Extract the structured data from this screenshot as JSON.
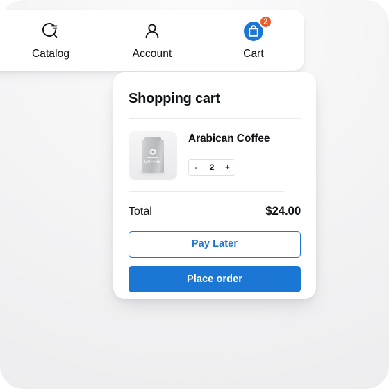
{
  "colors": {
    "accent_blue": "#1c77d4",
    "badge_orange": "#ec5b2b",
    "text_dark": "#111216",
    "panel_white": "#ffffff",
    "page_bg": "#ececee"
  },
  "navbar": {
    "items": [
      {
        "label": "Catalog",
        "icon": "catalog-search-icon"
      },
      {
        "label": "Account",
        "icon": "user-icon"
      },
      {
        "label": "Cart",
        "icon": "shopping-bag-icon",
        "badge": "2"
      }
    ]
  },
  "cart": {
    "title": "Shopping cart",
    "items": [
      {
        "name": "Arabican Coffee",
        "thumb_alt": "coffee-bag-image",
        "thumb_brand_text": "COFFEE",
        "quantity": "2",
        "decrement_label": "-",
        "increment_label": "+"
      }
    ],
    "total_label": "Total",
    "total_value": "$24.00",
    "pay_later_label": "Pay Later",
    "place_order_label": "Place order"
  }
}
